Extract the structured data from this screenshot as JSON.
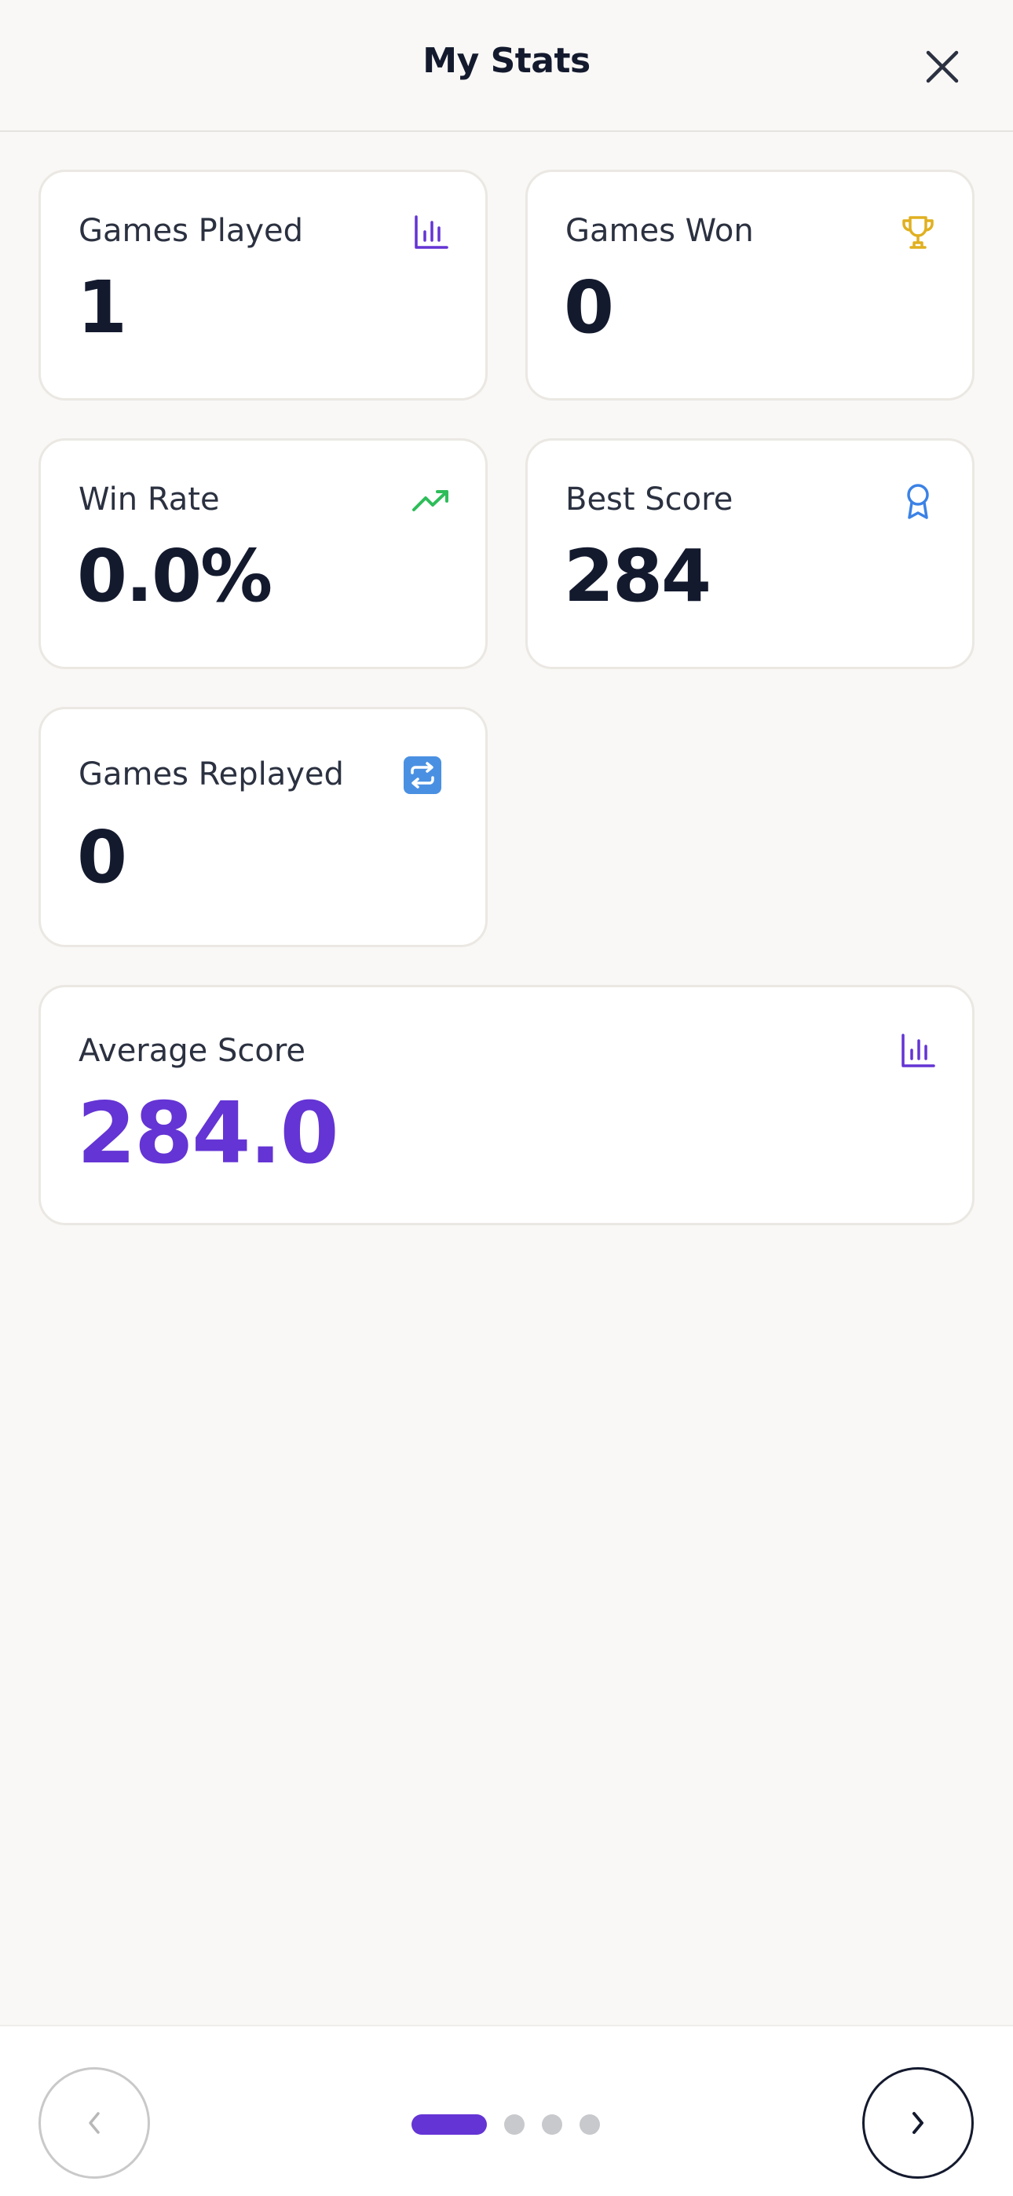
{
  "header": {
    "title": "My Stats",
    "close_icon": "close-icon"
  },
  "stats": {
    "games_played": {
      "label": "Games Played",
      "value": "1",
      "icon": "bar-chart-icon",
      "icon_color": "#6434d4"
    },
    "games_won": {
      "label": "Games Won",
      "value": "0",
      "icon": "trophy-icon",
      "icon_color": "#e0b020"
    },
    "win_rate": {
      "label": "Win Rate",
      "value": "0.0%",
      "icon": "trending-up-icon",
      "icon_color": "#2ebd5a"
    },
    "best_score": {
      "label": "Best Score",
      "value": "284",
      "icon": "award-ribbon-icon",
      "icon_color": "#3b82e6"
    },
    "games_replayed": {
      "label": "Games Replayed",
      "value": "0",
      "icon": "repeat-icon",
      "icon_color": "#4a90e2"
    },
    "average_score": {
      "label": "Average Score",
      "value": "284.0",
      "icon": "bar-chart-icon",
      "icon_color": "#6434d4"
    }
  },
  "pagination": {
    "total_pages": 4,
    "current_page": 1,
    "prev_icon": "chevron-left-icon",
    "next_icon": "chevron-right-icon"
  },
  "colors": {
    "accent": "#6434d4",
    "background": "#f9f8f6",
    "text": "#141a2e"
  }
}
